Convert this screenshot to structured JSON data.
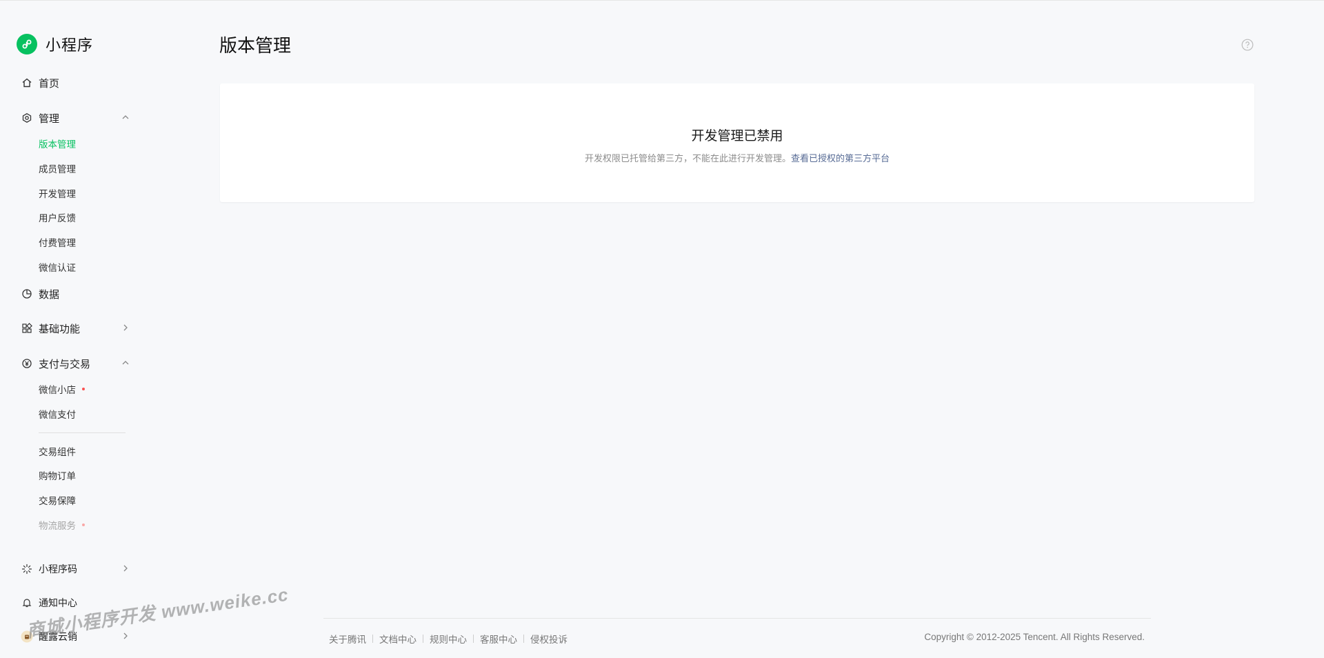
{
  "app": {
    "name": "小程序"
  },
  "sidebar": {
    "home": "首页",
    "manage": {
      "label": "管理",
      "items": [
        "版本管理",
        "成员管理",
        "开发管理",
        "用户反馈",
        "付费管理",
        "微信认证"
      ]
    },
    "data": "数据",
    "basic": "基础功能",
    "pay": {
      "label": "支付与交易",
      "items": [
        "微信小店",
        "微信支付",
        "交易组件",
        "购物订单",
        "交易保障",
        "物流服务"
      ]
    },
    "qrcode": "小程序码",
    "notify": "通知中心",
    "account": "醒露云销"
  },
  "main": {
    "title": "版本管理",
    "card": {
      "title": "开发管理已禁用",
      "desc": "开发权限已托管给第三方，不能在此进行开发管理。",
      "link": "查看已授权的第三方平台"
    }
  },
  "footer": {
    "links": [
      "关于腾讯",
      "文档中心",
      "规则中心",
      "客服中心",
      "侵权投诉"
    ],
    "copyright": "Copyright © 2012-2025 Tencent. All Rights Reserved."
  },
  "watermark": "商城小程序开发 www.weike.cc",
  "colors": {
    "accent": "#07c160",
    "link": "#576b95",
    "badge": "#fa5151"
  },
  "icons": [
    "home-icon",
    "settings-icon",
    "chevron-up-icon",
    "chevron-right-icon",
    "chart-icon",
    "grid-icon",
    "yuan-icon",
    "qrcode-icon",
    "bell-icon",
    "avatar",
    "help-icon"
  ]
}
